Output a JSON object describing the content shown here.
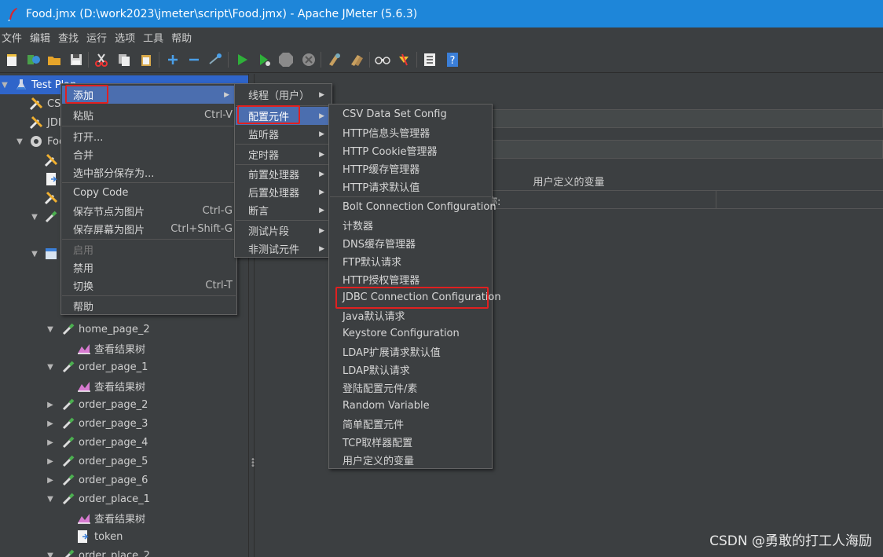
{
  "window": {
    "title": "Food.jmx (D:\\work2023\\jmeter\\script\\Food.jmx) - Apache JMeter (5.6.3)"
  },
  "menubar": [
    "文件",
    "编辑",
    "查找",
    "运行",
    "选项",
    "工具",
    "帮助"
  ],
  "toolbar": [
    {
      "icon": "new-icon"
    },
    {
      "icon": "templates-icon"
    },
    {
      "icon": "open-icon"
    },
    {
      "icon": "save-icon"
    },
    {
      "icon": "cut-icon"
    },
    {
      "icon": "copy-icon"
    },
    {
      "icon": "paste-icon"
    },
    {
      "icon": "expand-icon"
    },
    {
      "icon": "collapse-icon"
    },
    {
      "icon": "toggle-icon"
    },
    {
      "icon": "start-icon"
    },
    {
      "icon": "start-no-pause-icon"
    },
    {
      "icon": "stop-icon"
    },
    {
      "icon": "shutdown-icon"
    },
    {
      "icon": "clear-icon"
    },
    {
      "icon": "clear-all-icon"
    },
    {
      "icon": "search-icon"
    },
    {
      "icon": "reset-search-icon"
    },
    {
      "icon": "function-helper-icon"
    },
    {
      "icon": "help-icon"
    }
  ],
  "tree": [
    {
      "label": "Test Plan",
      "icon": "flask-icon"
    },
    {
      "label": "CS",
      "icon": "wrench-icon"
    },
    {
      "label": "JDI",
      "icon": "wrench-icon"
    },
    {
      "label": "Foo",
      "icon": "gear-icon"
    },
    {
      "label": "",
      "icon": "wrench-icon"
    },
    {
      "label": "",
      "icon": "document-icon"
    },
    {
      "label": "",
      "icon": "wrench-icon"
    },
    {
      "label": "",
      "icon": "pipette-icon"
    },
    {
      "label": "",
      "icon": "controller-icon"
    },
    {
      "label": "home_page_2",
      "icon": "pipette-icon"
    },
    {
      "label": "查看结果树",
      "icon": "result-tree-icon"
    },
    {
      "label": "order_page_1",
      "icon": "pipette-icon"
    },
    {
      "label": "查看结果树",
      "icon": "result-tree-icon"
    },
    {
      "label": "order_page_2",
      "icon": "pipette-icon"
    },
    {
      "label": "order_page_3",
      "icon": "pipette-icon"
    },
    {
      "label": "order_page_4",
      "icon": "pipette-icon"
    },
    {
      "label": "order_page_5",
      "icon": "pipette-icon"
    },
    {
      "label": "order_page_6",
      "icon": "pipette-icon"
    },
    {
      "label": "order_place_1",
      "icon": "pipette-icon"
    },
    {
      "label": "查看结果树",
      "icon": "result-tree-icon"
    },
    {
      "label": "token",
      "icon": "document-icon"
    },
    {
      "label": "order_place_2",
      "icon": "pipette-icon"
    }
  ],
  "right_panel": {
    "udv_label": "用户定义的变量",
    "name_col_fragment": "称:"
  },
  "context_menu": {
    "items": [
      {
        "label": "添加",
        "accel": ""
      },
      {
        "label": "粘贴",
        "accel": "Ctrl-V"
      },
      {
        "label": "打开...",
        "accel": ""
      },
      {
        "label": "合并",
        "accel": ""
      },
      {
        "label": "选中部分保存为...",
        "accel": ""
      },
      {
        "label": "Copy Code",
        "accel": ""
      },
      {
        "label": "保存节点为图片",
        "accel": "Ctrl-G"
      },
      {
        "label": "保存屏幕为图片",
        "accel": "Ctrl+Shift-G"
      },
      {
        "label": "启用",
        "accel": ""
      },
      {
        "label": "禁用",
        "accel": ""
      },
      {
        "label": "切换",
        "accel": "Ctrl-T"
      },
      {
        "label": "帮助",
        "accel": ""
      }
    ]
  },
  "add_submenu": {
    "items": [
      "线程（用户）",
      "配置元件",
      "监听器",
      "定时器",
      "前置处理器",
      "后置处理器",
      "断言",
      "测试片段",
      "非测试元件"
    ]
  },
  "config_submenu": {
    "items": [
      "CSV Data Set Config",
      "HTTP信息头管理器",
      "HTTP Cookie管理器",
      "HTTP缓存管理器",
      "HTTP请求默认值",
      "Bolt Connection Configuration",
      "计数器",
      "DNS缓存管理器",
      "FTP默认请求",
      "HTTP授权管理器",
      "JDBC Connection Configuration",
      "Java默认请求",
      "Keystore Configuration",
      "LDAP扩展请求默认值",
      "LDAP默认请求",
      "登陆配置元件/素",
      "Random Variable",
      "简单配置元件",
      "TCP取样器配置",
      "用户定义的变量"
    ]
  },
  "watermark": "CSDN @勇敢的打工人海励",
  "colors": {
    "titlebar": "#1e86d9",
    "background": "#3c3f41",
    "selection": "#4b6eaf",
    "highlight": "#e02020"
  }
}
